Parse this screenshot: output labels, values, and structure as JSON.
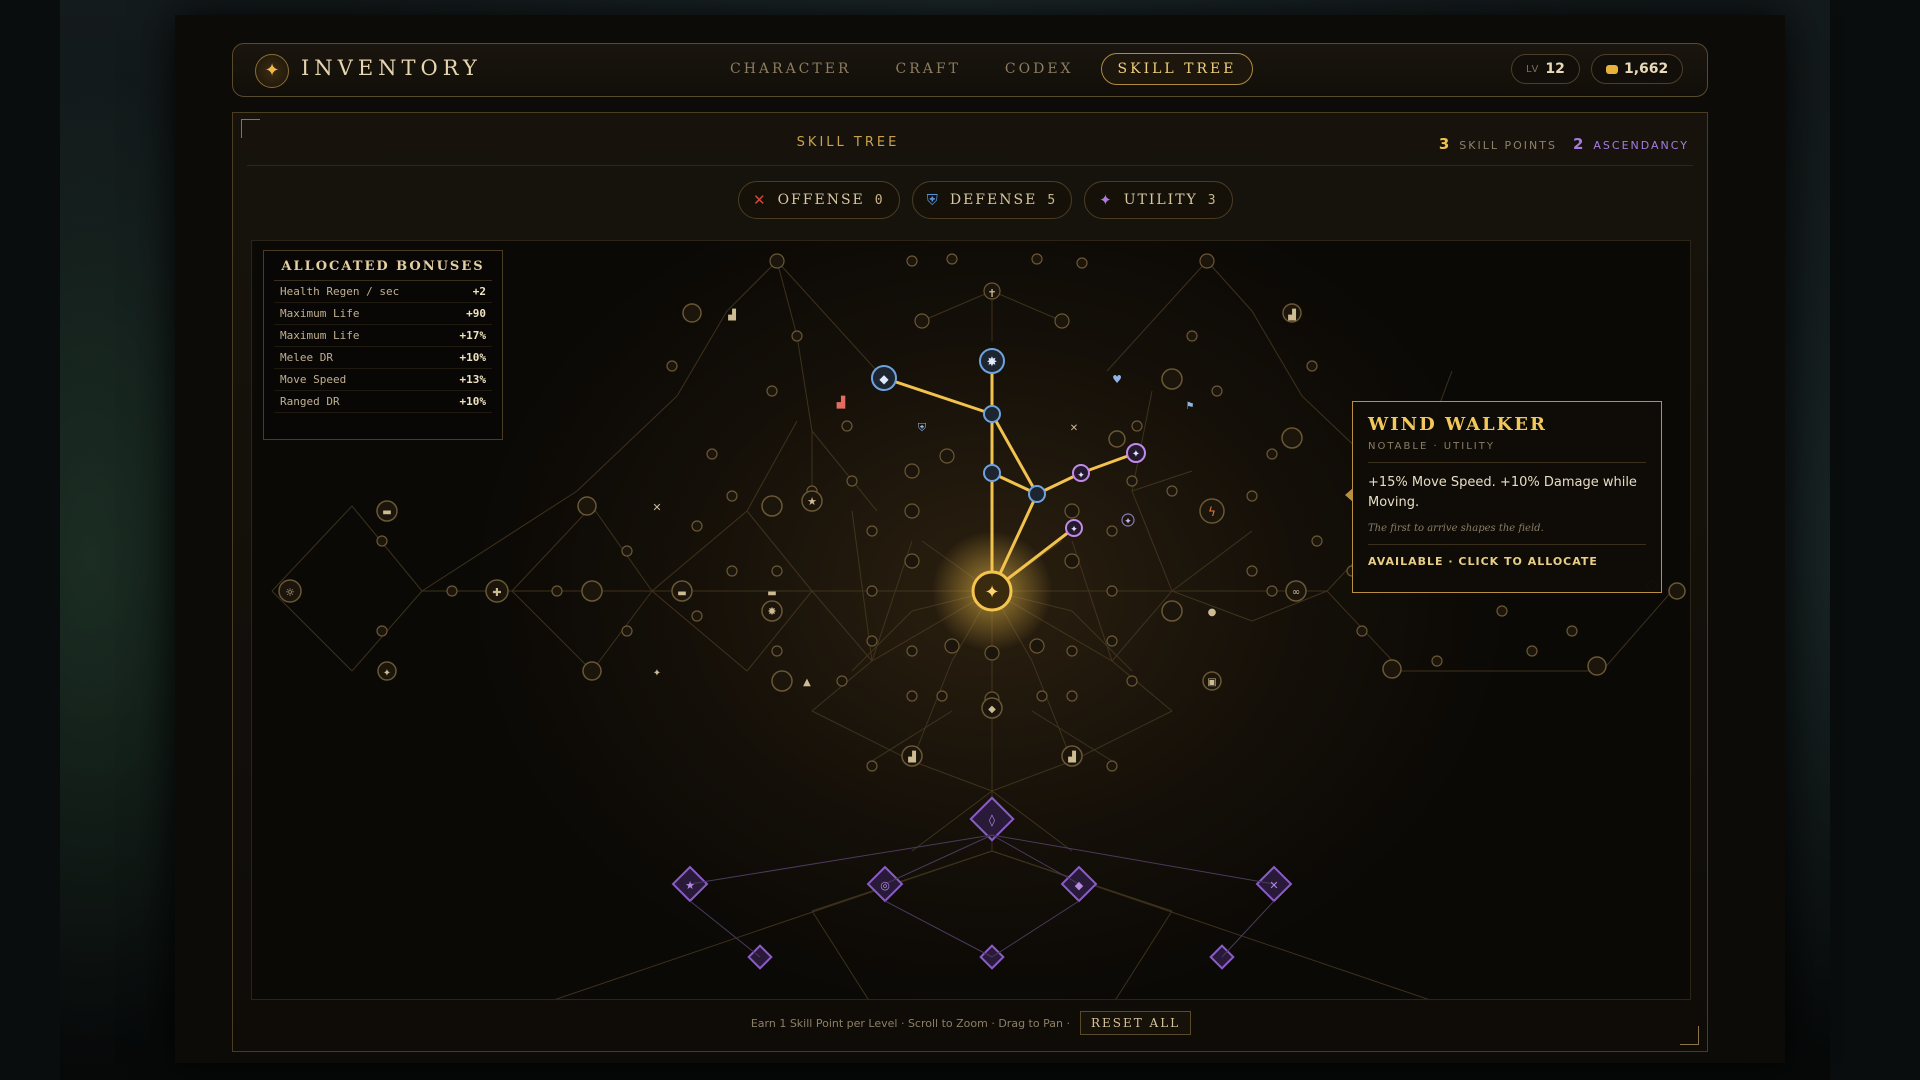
{
  "header": {
    "app_title": "INVENTORY",
    "logo_icon": "compass-star-icon",
    "tabs": [
      {
        "label": "CHARACTER",
        "active": false
      },
      {
        "label": "CRAFT",
        "active": false
      },
      {
        "label": "CODEX",
        "active": false
      },
      {
        "label": "SKILL TREE",
        "active": true
      }
    ],
    "level_label": "LV",
    "level_value": "12",
    "gold_value": "1,662"
  },
  "panel": {
    "title": "SKILL TREE",
    "skill_points_value": "3",
    "skill_points_label": "SKILL POINTS",
    "ascendancy_value": "2",
    "ascendancy_label": "ASCENDANCY"
  },
  "filters": [
    {
      "label": "OFFENSE",
      "count": "0",
      "icon": "crossed-swords-icon",
      "color": "#d9453a"
    },
    {
      "label": "DEFENSE",
      "count": "5",
      "icon": "shield-icon",
      "color": "#5b8fd6"
    },
    {
      "label": "UTILITY",
      "count": "3",
      "icon": "sparkle-icon",
      "color": "#b277e0"
    }
  ],
  "bonuses": {
    "title": "ALLOCATED BONUSES",
    "rows": [
      {
        "name": "Health Regen / sec",
        "value": "+2"
      },
      {
        "name": "Maximum Life",
        "value": "+90"
      },
      {
        "name": "Maximum Life",
        "value": "+17%"
      },
      {
        "name": "Melee DR",
        "value": "+10%"
      },
      {
        "name": "Move Speed",
        "value": "+13%"
      },
      {
        "name": "Ranged DR",
        "value": "+10%"
      }
    ]
  },
  "tooltip": {
    "name": "WIND WALKER",
    "type": "NOTABLE · UTILITY",
    "description": "+15% Move Speed. +10% Damage while Moving.",
    "flavor": "The first to arrive shapes the field.",
    "action": "AVAILABLE · CLICK TO ALLOCATE"
  },
  "footer": {
    "hint": "Earn 1 Skill Point per Level · Scroll to Zoom · Drag to Pan ·",
    "reset_label": "RESET ALL"
  },
  "colors": {
    "gold": "#f0c14e",
    "defense": "#5b8fd6",
    "utility": "#b277e0",
    "path": "#f2c24f",
    "ascendancy": "#7b4fb0"
  }
}
